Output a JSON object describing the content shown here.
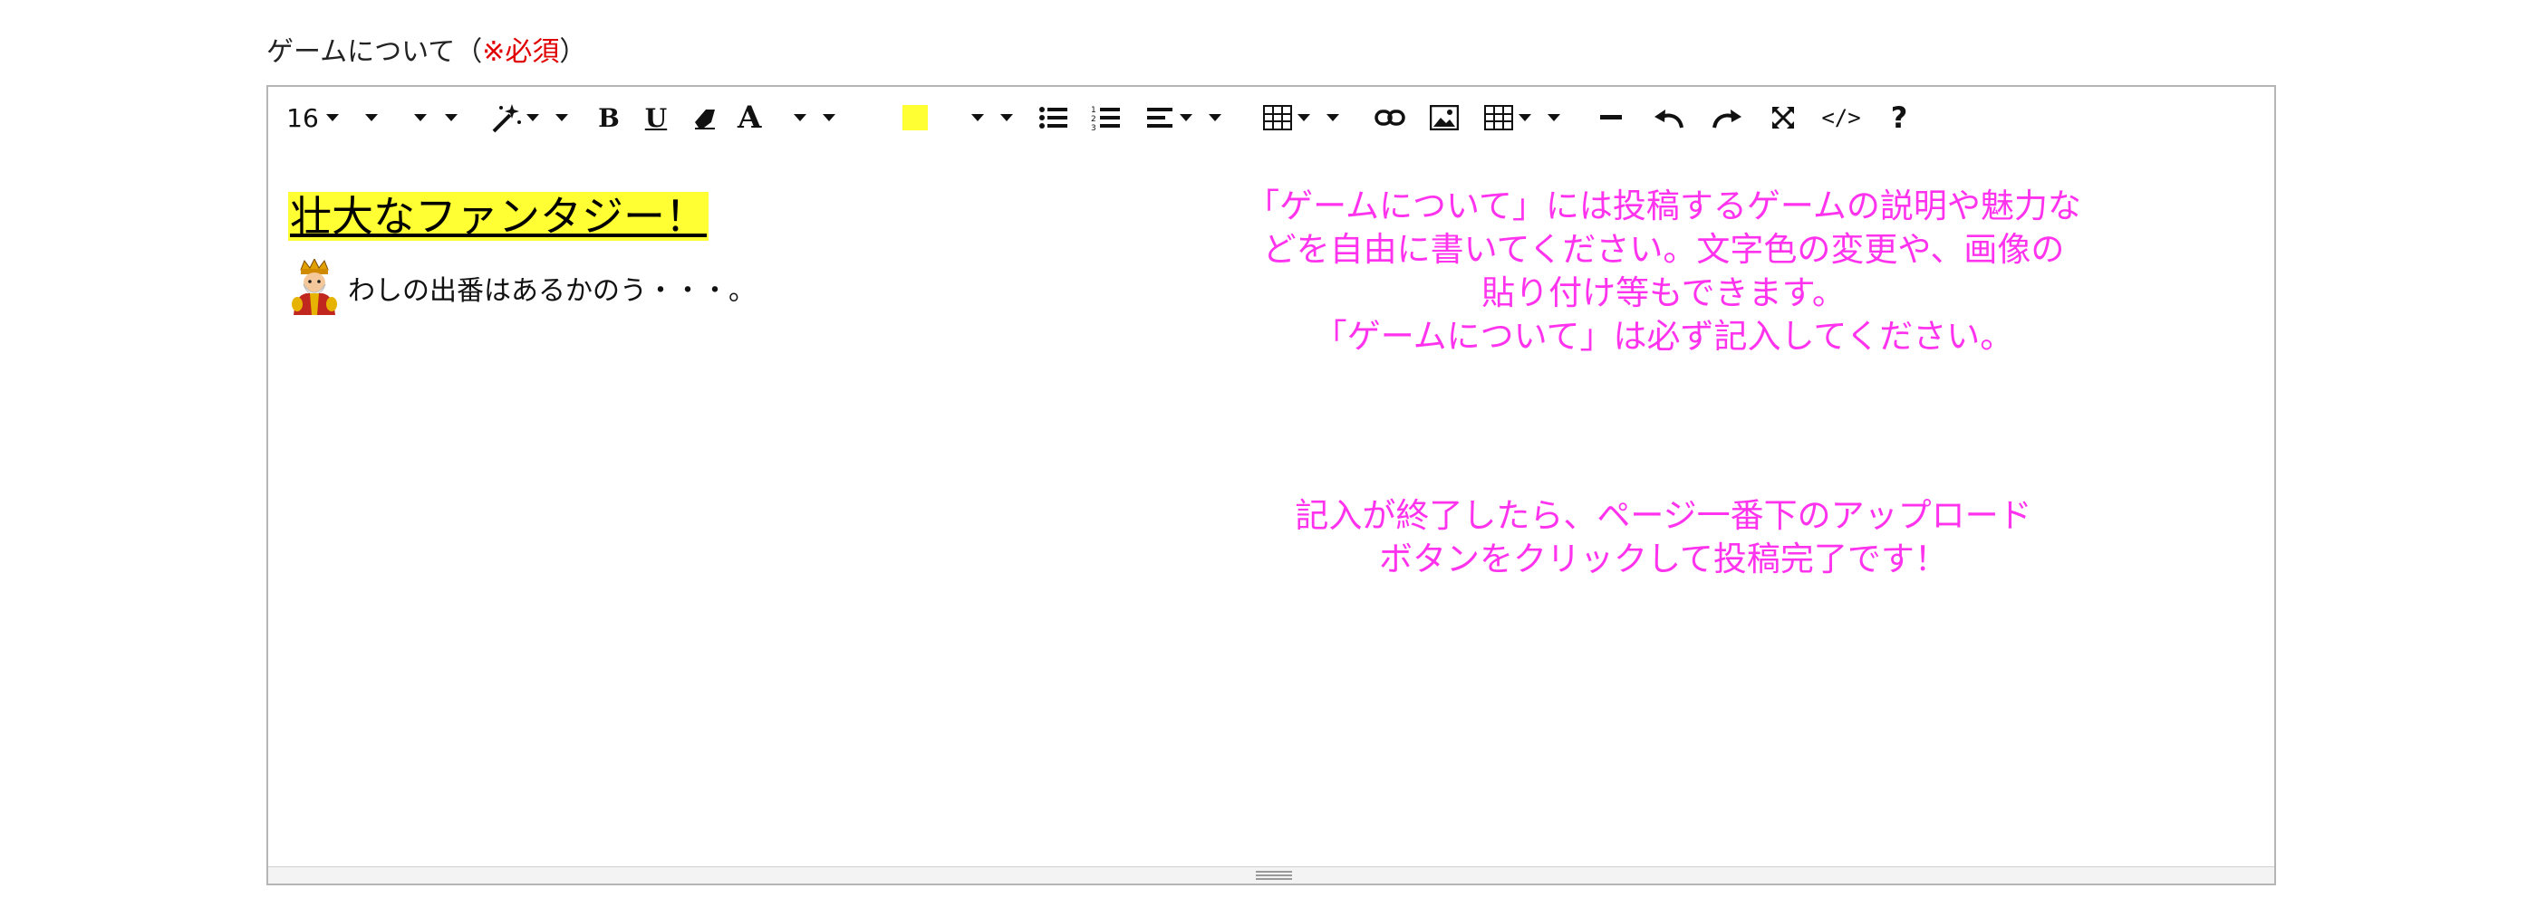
{
  "field": {
    "label": "ゲームについて（",
    "required": "※必須",
    "label_end": "）"
  },
  "toolbar": {
    "font_size": "16",
    "items": [
      "font-size-dropdown",
      "font-family-dropdown",
      "style-dropdown",
      "magic-style-dropdown",
      "bold",
      "underline",
      "eraser",
      "font-color",
      "highlight-color",
      "unordered-list",
      "ordered-list",
      "paragraph-align",
      "table",
      "link",
      "image",
      "table-2",
      "horizontal-rule",
      "undo",
      "redo",
      "fullscreen",
      "code-view",
      "help"
    ],
    "code_view_label": "</>",
    "help_label": "?",
    "bold_label": "B",
    "underline_label": "U",
    "font_color_label": "A",
    "highlight_color": "#ffff33"
  },
  "editor": {
    "heading": "壮大なファンタジー！",
    "line": "わしの出番はあるかのう・・・。",
    "hint_lines_1": [
      "「ゲームについて」には投稿するゲームの説明や魅力な",
      "どを自由に書いてください。文字色の変更や、画像の",
      "貼り付け等もできます。",
      "「ゲームについて」は必ず記入してください。"
    ],
    "hint_lines_2": [
      "記入が終了したら、ページ一番下のアップロード",
      "ボタンをクリックして投稿完了です！"
    ],
    "hint_color": "#ff33ee"
  },
  "colors": {
    "required": "#e00000",
    "highlight": "#ffff33",
    "border": "#b5b5b5"
  }
}
